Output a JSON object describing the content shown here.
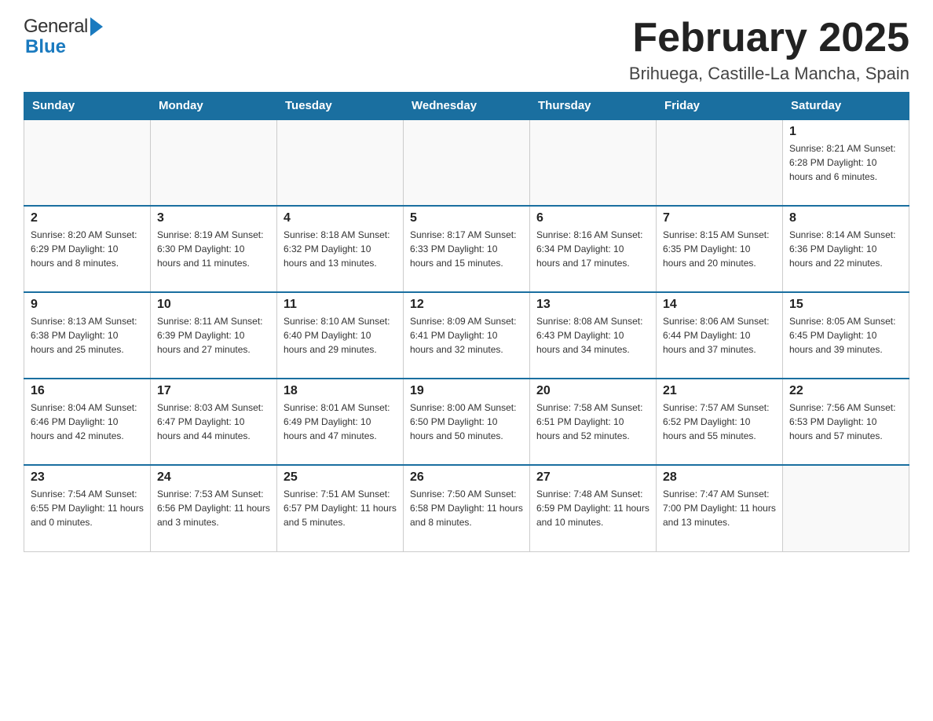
{
  "header": {
    "logo_general": "General",
    "logo_blue": "Blue",
    "month_title": "February 2025",
    "location": "Brihuega, Castille-La Mancha, Spain"
  },
  "days_of_week": [
    "Sunday",
    "Monday",
    "Tuesday",
    "Wednesday",
    "Thursday",
    "Friday",
    "Saturday"
  ],
  "weeks": [
    [
      {
        "day": "",
        "info": ""
      },
      {
        "day": "",
        "info": ""
      },
      {
        "day": "",
        "info": ""
      },
      {
        "day": "",
        "info": ""
      },
      {
        "day": "",
        "info": ""
      },
      {
        "day": "",
        "info": ""
      },
      {
        "day": "1",
        "info": "Sunrise: 8:21 AM\nSunset: 6:28 PM\nDaylight: 10 hours and 6 minutes."
      }
    ],
    [
      {
        "day": "2",
        "info": "Sunrise: 8:20 AM\nSunset: 6:29 PM\nDaylight: 10 hours and 8 minutes."
      },
      {
        "day": "3",
        "info": "Sunrise: 8:19 AM\nSunset: 6:30 PM\nDaylight: 10 hours and 11 minutes."
      },
      {
        "day": "4",
        "info": "Sunrise: 8:18 AM\nSunset: 6:32 PM\nDaylight: 10 hours and 13 minutes."
      },
      {
        "day": "5",
        "info": "Sunrise: 8:17 AM\nSunset: 6:33 PM\nDaylight: 10 hours and 15 minutes."
      },
      {
        "day": "6",
        "info": "Sunrise: 8:16 AM\nSunset: 6:34 PM\nDaylight: 10 hours and 17 minutes."
      },
      {
        "day": "7",
        "info": "Sunrise: 8:15 AM\nSunset: 6:35 PM\nDaylight: 10 hours and 20 minutes."
      },
      {
        "day": "8",
        "info": "Sunrise: 8:14 AM\nSunset: 6:36 PM\nDaylight: 10 hours and 22 minutes."
      }
    ],
    [
      {
        "day": "9",
        "info": "Sunrise: 8:13 AM\nSunset: 6:38 PM\nDaylight: 10 hours and 25 minutes."
      },
      {
        "day": "10",
        "info": "Sunrise: 8:11 AM\nSunset: 6:39 PM\nDaylight: 10 hours and 27 minutes."
      },
      {
        "day": "11",
        "info": "Sunrise: 8:10 AM\nSunset: 6:40 PM\nDaylight: 10 hours and 29 minutes."
      },
      {
        "day": "12",
        "info": "Sunrise: 8:09 AM\nSunset: 6:41 PM\nDaylight: 10 hours and 32 minutes."
      },
      {
        "day": "13",
        "info": "Sunrise: 8:08 AM\nSunset: 6:43 PM\nDaylight: 10 hours and 34 minutes."
      },
      {
        "day": "14",
        "info": "Sunrise: 8:06 AM\nSunset: 6:44 PM\nDaylight: 10 hours and 37 minutes."
      },
      {
        "day": "15",
        "info": "Sunrise: 8:05 AM\nSunset: 6:45 PM\nDaylight: 10 hours and 39 minutes."
      }
    ],
    [
      {
        "day": "16",
        "info": "Sunrise: 8:04 AM\nSunset: 6:46 PM\nDaylight: 10 hours and 42 minutes."
      },
      {
        "day": "17",
        "info": "Sunrise: 8:03 AM\nSunset: 6:47 PM\nDaylight: 10 hours and 44 minutes."
      },
      {
        "day": "18",
        "info": "Sunrise: 8:01 AM\nSunset: 6:49 PM\nDaylight: 10 hours and 47 minutes."
      },
      {
        "day": "19",
        "info": "Sunrise: 8:00 AM\nSunset: 6:50 PM\nDaylight: 10 hours and 50 minutes."
      },
      {
        "day": "20",
        "info": "Sunrise: 7:58 AM\nSunset: 6:51 PM\nDaylight: 10 hours and 52 minutes."
      },
      {
        "day": "21",
        "info": "Sunrise: 7:57 AM\nSunset: 6:52 PM\nDaylight: 10 hours and 55 minutes."
      },
      {
        "day": "22",
        "info": "Sunrise: 7:56 AM\nSunset: 6:53 PM\nDaylight: 10 hours and 57 minutes."
      }
    ],
    [
      {
        "day": "23",
        "info": "Sunrise: 7:54 AM\nSunset: 6:55 PM\nDaylight: 11 hours and 0 minutes."
      },
      {
        "day": "24",
        "info": "Sunrise: 7:53 AM\nSunset: 6:56 PM\nDaylight: 11 hours and 3 minutes."
      },
      {
        "day": "25",
        "info": "Sunrise: 7:51 AM\nSunset: 6:57 PM\nDaylight: 11 hours and 5 minutes."
      },
      {
        "day": "26",
        "info": "Sunrise: 7:50 AM\nSunset: 6:58 PM\nDaylight: 11 hours and 8 minutes."
      },
      {
        "day": "27",
        "info": "Sunrise: 7:48 AM\nSunset: 6:59 PM\nDaylight: 11 hours and 10 minutes."
      },
      {
        "day": "28",
        "info": "Sunrise: 7:47 AM\nSunset: 7:00 PM\nDaylight: 11 hours and 13 minutes."
      },
      {
        "day": "",
        "info": ""
      }
    ]
  ]
}
